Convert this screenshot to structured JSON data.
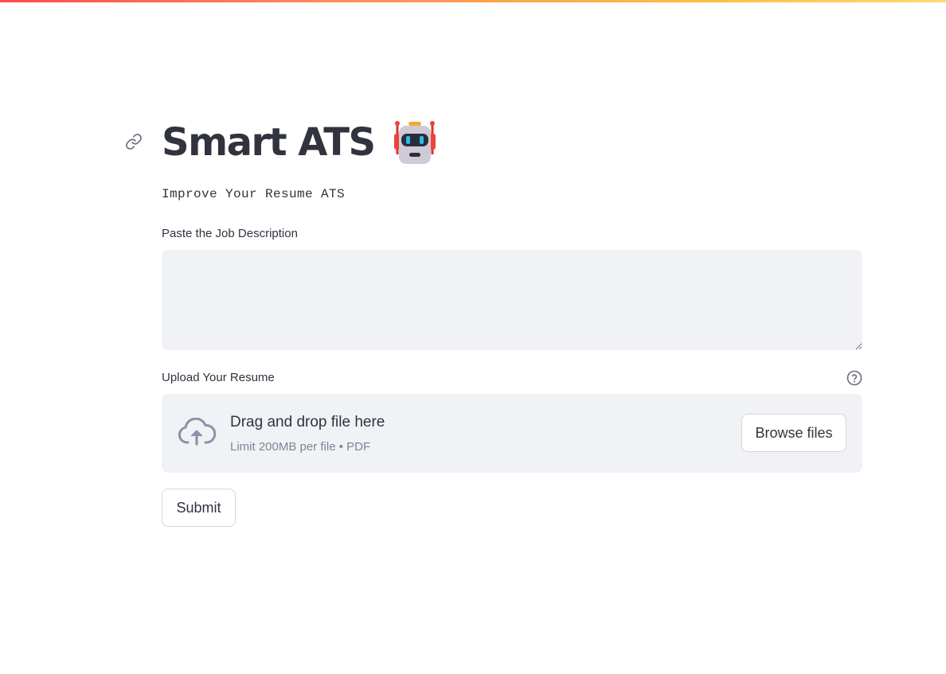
{
  "header": {
    "title": "Smart ATS",
    "title_emoji_icon": "robot-face-icon",
    "subtitle": "Improve Your Resume ATS"
  },
  "job_description": {
    "label": "Paste the Job Description",
    "value": "",
    "placeholder": ""
  },
  "resume_upload": {
    "label": "Upload Your Resume",
    "dropzone_title": "Drag and drop file here",
    "dropzone_limit": "Limit 200MB per file • PDF",
    "browse_label": "Browse files"
  },
  "actions": {
    "submit_label": "Submit"
  },
  "colors": {
    "text": "#31333f",
    "muted": "#808495",
    "input_bg": "#f0f2f6",
    "accent_red": "#ff4b4b",
    "accent_yellow": "#ffbd45"
  }
}
